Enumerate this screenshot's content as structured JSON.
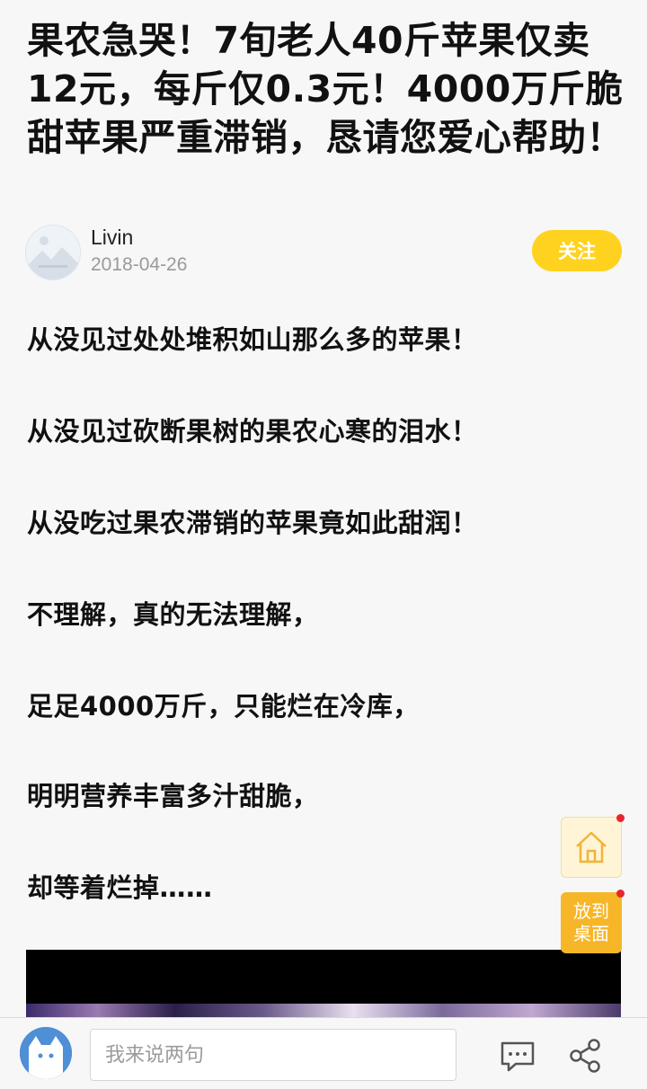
{
  "article": {
    "title": "果农急哭！7旬老人40斤苹果仅卖12元，每斤仅0.3元！4000万斤脆甜苹果严重滞销，恳请您爱心帮助！",
    "author": {
      "name": "Livin",
      "date": "2018-04-26",
      "follow_label": "关注"
    },
    "paragraphs": [
      "从没见过处处堆积如山那么多的苹果！",
      "从没见过砍断果树的果农心寒的泪水！",
      "从没吃过果农滞销的苹果竟如此甜润！",
      "不理解，真的无法理解，",
      "足足4000万斤，只能烂在冷库，",
      "明明营养丰富多汁甜脆，",
      "却等着烂掉……"
    ]
  },
  "floating": {
    "home_icon": "home-icon",
    "desktop_line1": "放到",
    "desktop_line2": "桌面"
  },
  "bottom_bar": {
    "comment_placeholder": "我来说两句",
    "comment_icon": "comment-icon",
    "share_icon": "share-icon"
  },
  "colors": {
    "accent": "#ffd21f",
    "desktop_button": "#f7b627",
    "badge": "#e8252f"
  }
}
